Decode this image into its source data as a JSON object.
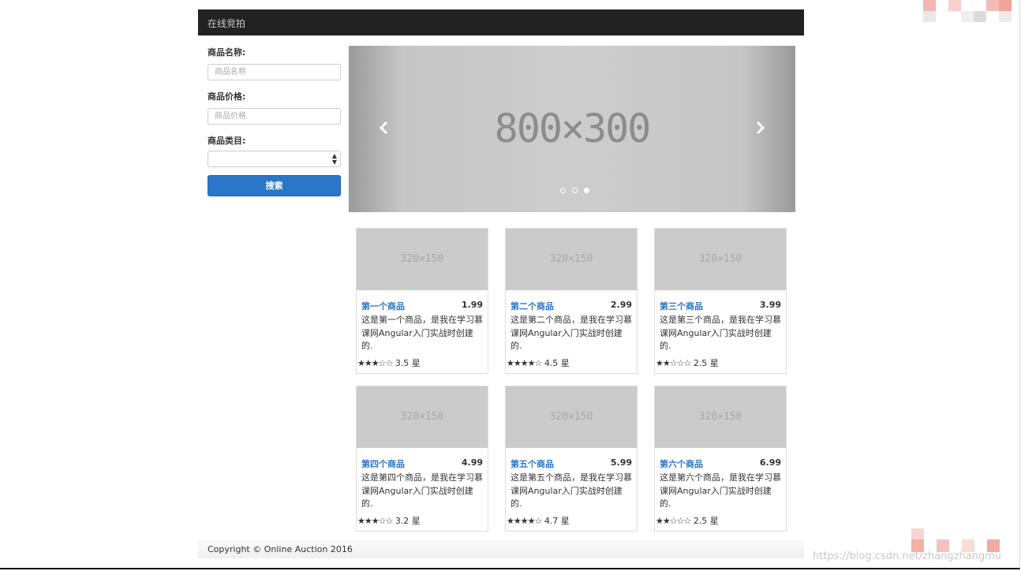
{
  "app": {
    "brand": "在线竞拍"
  },
  "search": {
    "name_label": "商品名称:",
    "name_placeholder": "商品名称",
    "price_label": "商品价格:",
    "price_placeholder": "商品价格",
    "category_label": "商品类目:",
    "category_value": "",
    "submit_label": "搜索"
  },
  "carousel": {
    "image_text": "800×300",
    "indicator_count": 3,
    "active_indicator": 3
  },
  "products": [
    {
      "title": "第一个商品",
      "price": "1.99",
      "description": "这是第一个商品，是我在学习慕课网Angular入门实战时创建的.",
      "stars": "★★★☆☆",
      "rating": "3.5 星",
      "image_text": "320×150"
    },
    {
      "title": "第二个商品",
      "price": "2.99",
      "description": "这是第二个商品，是我在学习慕课网Angular入门实战时创建的.",
      "stars": "★★★★☆",
      "rating": "4.5 星",
      "image_text": "320×150"
    },
    {
      "title": "第三个商品",
      "price": "3.99",
      "description": "这是第三个商品，是我在学习慕课网Angular入门实战时创建的.",
      "stars": "★★☆☆☆",
      "rating": "2.5 星",
      "image_text": "320×150"
    },
    {
      "title": "第四个商品",
      "price": "4.99",
      "description": "这是第四个商品，是我在学习慕课网Angular入门实战时创建的.",
      "stars": "★★★☆☆",
      "rating": "3.2 星",
      "image_text": "320×150"
    },
    {
      "title": "第五个商品",
      "price": "5.99",
      "description": "这是第五个商品，是我在学习慕课网Angular入门实战时创建的.",
      "stars": "★★★★☆",
      "rating": "4.7 星",
      "image_text": "320×150"
    },
    {
      "title": "第六个商品",
      "price": "6.99",
      "description": "这是第六个商品，是我在学习慕课网Angular入门实战时创建的.",
      "stars": "★★☆☆☆",
      "rating": "2.5 星",
      "image_text": "320×150"
    }
  ],
  "footer": {
    "copyright": "Copyright © Online Auction 2016"
  },
  "watermark": {
    "text": "https://blog.csdn.net/zhangzhangmu"
  },
  "colors": {
    "navbar": "#222222",
    "primary": "#2a76c9",
    "placeholder_image": "#cbcbcb"
  }
}
